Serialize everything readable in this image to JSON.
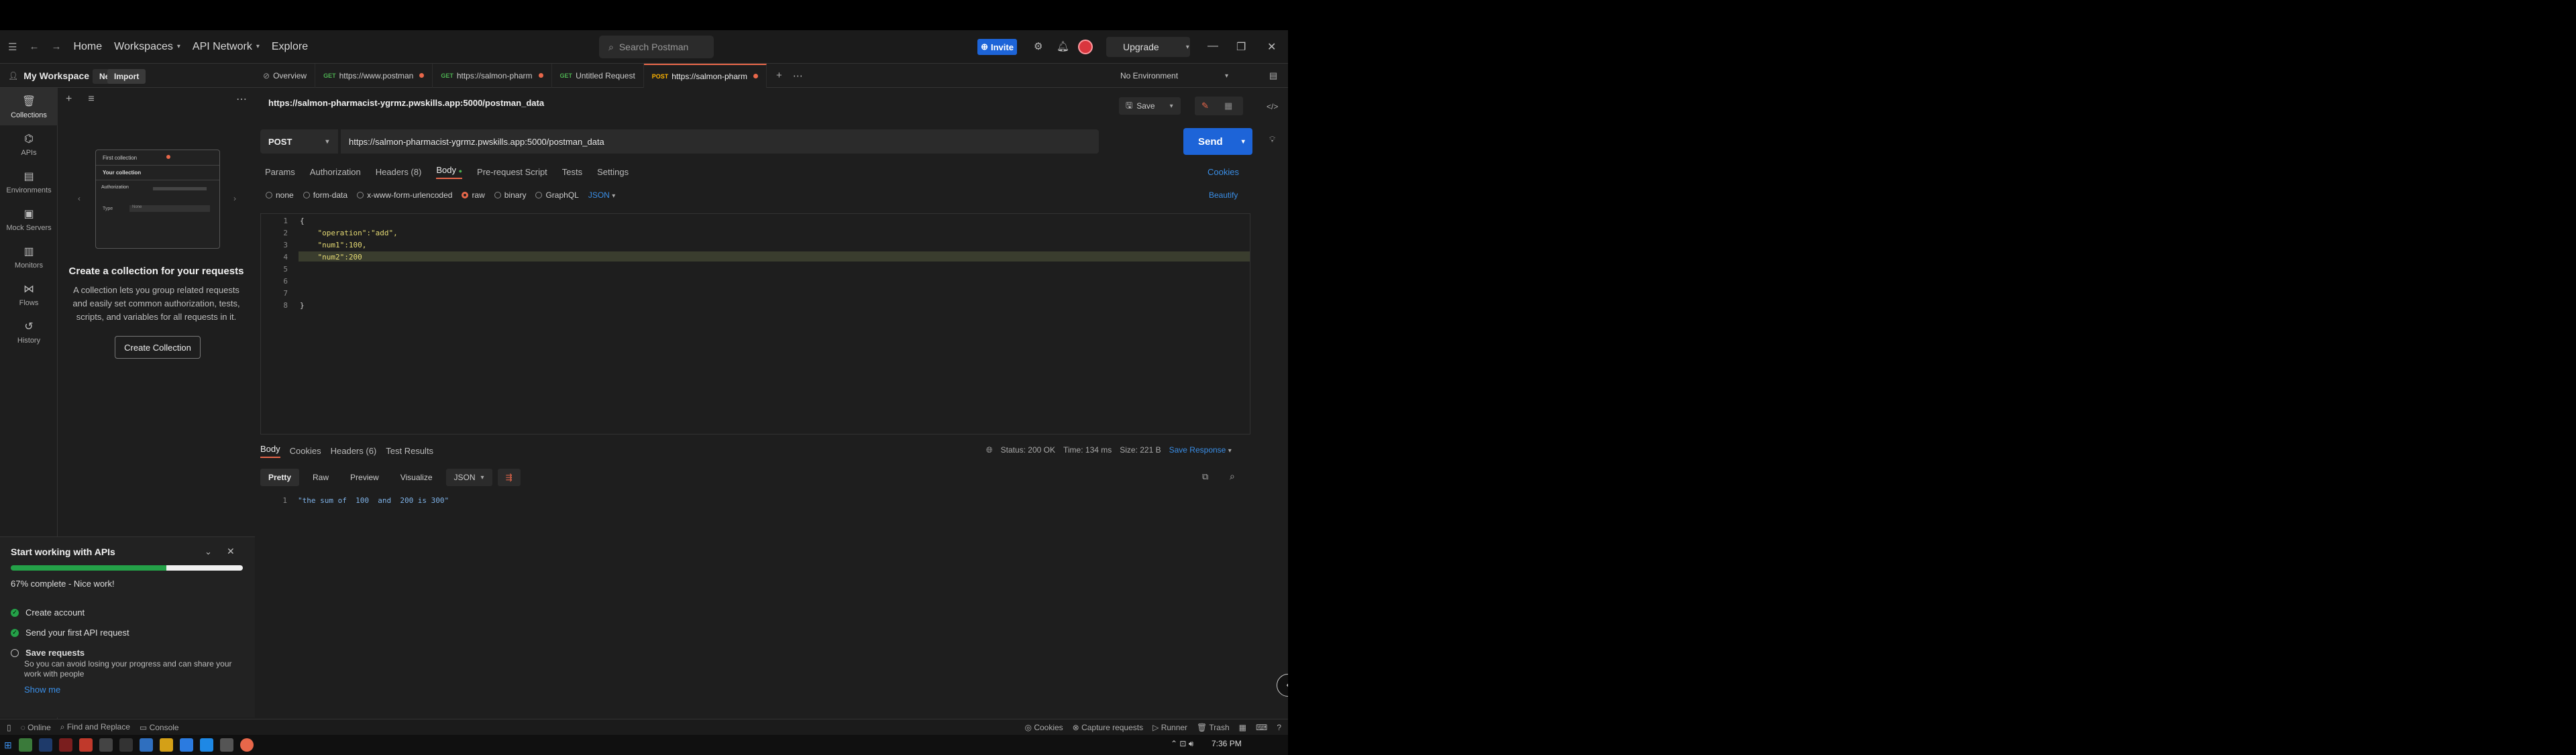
{
  "header": {
    "home": "Home",
    "workspaces": "Workspaces",
    "api_network": "API Network",
    "explore": "Explore",
    "search_placeholder": "Search Postman",
    "invite": "Invite",
    "upgrade": "Upgrade"
  },
  "workspace": {
    "name": "My Workspace",
    "new_label": "New",
    "import_label": "Import"
  },
  "nav": [
    {
      "label": "Collections",
      "icon": "collections-icon"
    },
    {
      "label": "APIs",
      "icon": "api-icon"
    },
    {
      "label": "Environments",
      "icon": "environments-icon"
    },
    {
      "label": "Mock Servers",
      "icon": "mock-servers-icon"
    },
    {
      "label": "Monitors",
      "icon": "monitors-icon"
    },
    {
      "label": "Flows",
      "icon": "flows-icon"
    },
    {
      "label": "History",
      "icon": "history-icon"
    }
  ],
  "empty_state": {
    "illus_title": "First collection",
    "illus_subtitle": "Your collection",
    "illus_tab": "Authorization",
    "illus_field": "Type",
    "illus_value": "None",
    "title": "Create a collection for your requests",
    "description": "A collection lets you group related requests and easily set common authorization, tests, scripts, and variables for all requests in it.",
    "button": "Create Collection"
  },
  "onboarding": {
    "title": "Start working with APIs",
    "progress": 0.67,
    "progress_label": "67% complete - Nice work!",
    "steps": [
      {
        "label": "Create account",
        "done": true
      },
      {
        "label": "Send your first API request",
        "done": true
      },
      {
        "label": "Save requests",
        "done": false
      }
    ],
    "save_desc": "So you can avoid losing your progress and can share your work with people",
    "show_me": "Show me"
  },
  "tabs": [
    {
      "method": "",
      "label": "Overview"
    },
    {
      "method": "GET",
      "label": "https://www.postman"
    },
    {
      "method": "GET",
      "label": "https://salmon-pharm"
    },
    {
      "method": "GET",
      "label": "Untitled Request"
    },
    {
      "method": "POST",
      "label": "https://salmon-pharm"
    }
  ],
  "environment": "No Environment",
  "request": {
    "title": "https://salmon-pharmacist-ygrmz.pwskills.app:5000/postman_data",
    "save": "Save",
    "method": "POST",
    "url": "https://salmon-pharmacist-ygrmz.pwskills.app:5000/postman_data",
    "send": "Send",
    "tabs": [
      "Params",
      "Authorization",
      "Headers (8)",
      "Body",
      "Pre-request Script",
      "Tests",
      "Settings"
    ],
    "cookies": "Cookies",
    "body_types": [
      "none",
      "form-data",
      "x-www-form-urlencoded",
      "raw",
      "binary",
      "GraphQL"
    ],
    "format": "JSON",
    "beautify": "Beautify",
    "code_lines": [
      "{",
      "    \"operation\":\"add\",",
      "    \"num1\":100,",
      "    \"num2\":200",
      "",
      "",
      "",
      "}"
    ]
  },
  "response": {
    "tabs": [
      "Body",
      "Cookies",
      "Headers (6)",
      "Test Results"
    ],
    "status": "Status: 200 OK",
    "time": "Time: 134 ms",
    "size": "Size: 221 B",
    "save_response": "Save Response",
    "formats": [
      "Pretty",
      "Raw",
      "Preview",
      "Visualize"
    ],
    "format": "JSON",
    "body_line": "\"the sum of  100  and  200 is 300\""
  },
  "footer": {
    "online": "Online",
    "find_replace": "Find and Replace",
    "console": "Console",
    "cookies": "Cookies",
    "capture": "Capture requests",
    "runner": "Runner",
    "trash": "Trash"
  },
  "taskbar": {
    "time": "7:36 PM"
  },
  "colors": {
    "accent": "#e8674a",
    "primary_blue": "#1d64d8",
    "status_green": "#4caf50"
  }
}
